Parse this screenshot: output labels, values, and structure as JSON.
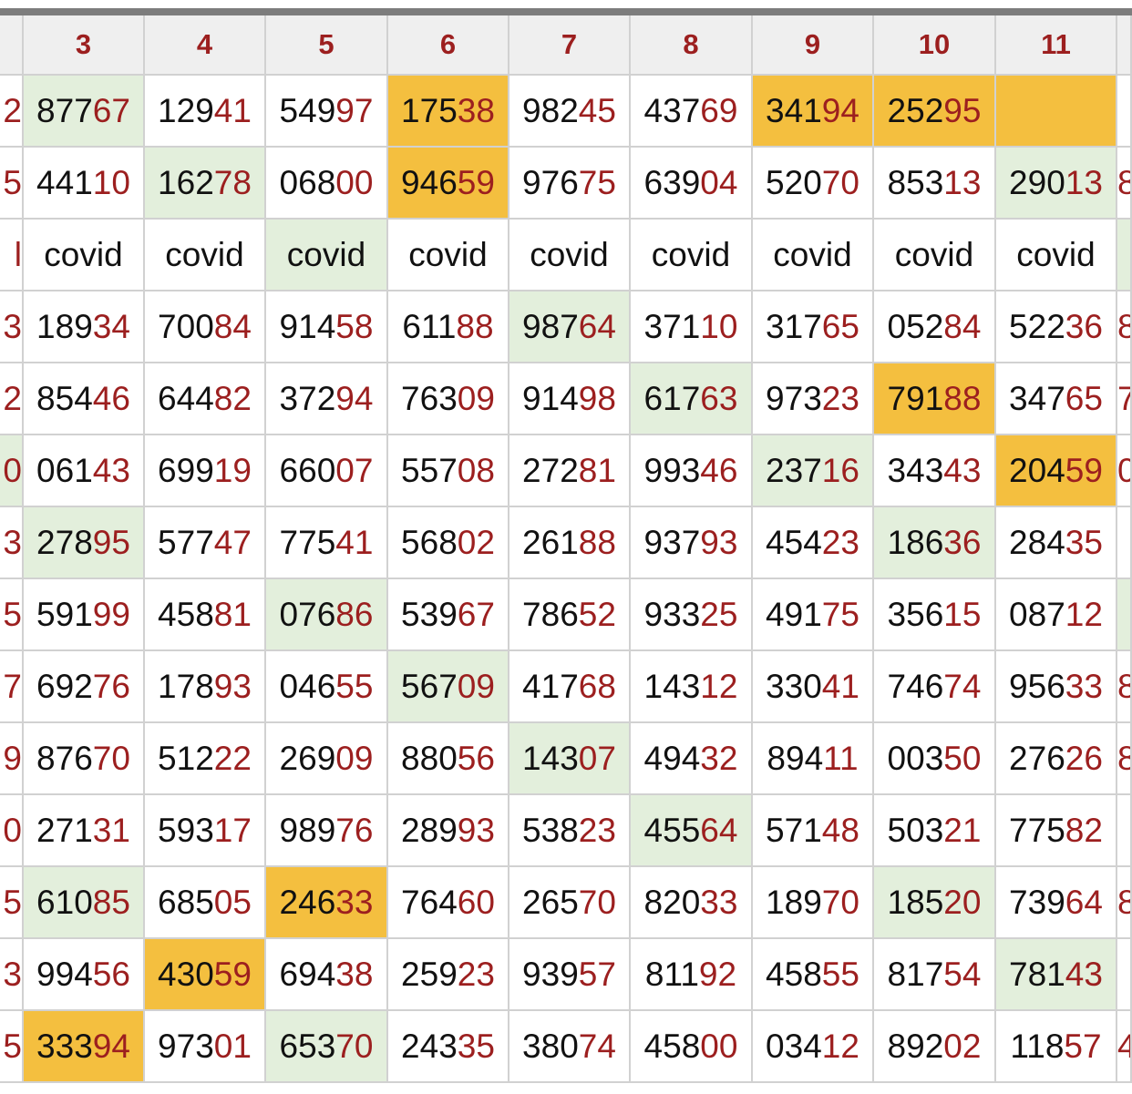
{
  "colors": {
    "green": "#e3efdc",
    "orange": "#f4bf3f",
    "digit_accent": "#9c1f1f",
    "header_bg": "#efefef",
    "grid_line": "#d1d1d1"
  },
  "header": [
    "",
    "3",
    "4",
    "5",
    "6",
    "7",
    "8",
    "9",
    "10",
    "11",
    ""
  ],
  "rows": [
    {
      "cells": [
        {
          "text": "2"
        },
        {
          "text": "87767",
          "hl": "green"
        },
        {
          "text": "12941"
        },
        {
          "text": "54997"
        },
        {
          "text": "17538",
          "hl": "orange"
        },
        {
          "text": "98245"
        },
        {
          "text": "43769"
        },
        {
          "text": "34194",
          "hl": "orange"
        },
        {
          "text": "25295",
          "hl": "orange"
        },
        {
          "text": "",
          "hl": "orange"
        },
        {
          "text": ""
        }
      ]
    },
    {
      "cells": [
        {
          "text": "5"
        },
        {
          "text": "44110"
        },
        {
          "text": "16278",
          "hl": "green"
        },
        {
          "text": "06800"
        },
        {
          "text": "94659",
          "hl": "orange"
        },
        {
          "text": "97675"
        },
        {
          "text": "63904"
        },
        {
          "text": "52070"
        },
        {
          "text": "85313"
        },
        {
          "text": "29013",
          "hl": "green"
        },
        {
          "text": "8"
        }
      ]
    },
    {
      "cells": [
        {
          "text": "l"
        },
        {
          "text": "covid"
        },
        {
          "text": "covid"
        },
        {
          "text": "covid",
          "hl": "green"
        },
        {
          "text": "covid"
        },
        {
          "text": "covid"
        },
        {
          "text": "covid"
        },
        {
          "text": "covid"
        },
        {
          "text": "covid"
        },
        {
          "text": "covid"
        },
        {
          "text": "",
          "hl": "green"
        }
      ]
    },
    {
      "cells": [
        {
          "text": "3"
        },
        {
          "text": "18934"
        },
        {
          "text": "70084"
        },
        {
          "text": "91458"
        },
        {
          "text": "61188"
        },
        {
          "text": "98764",
          "hl": "green"
        },
        {
          "text": "37110"
        },
        {
          "text": "31765"
        },
        {
          "text": "05284"
        },
        {
          "text": "52236"
        },
        {
          "text": "8"
        }
      ]
    },
    {
      "cells": [
        {
          "text": "2"
        },
        {
          "text": "85446"
        },
        {
          "text": "64482"
        },
        {
          "text": "37294"
        },
        {
          "text": "76309"
        },
        {
          "text": "91498"
        },
        {
          "text": "61763",
          "hl": "green"
        },
        {
          "text": "97323"
        },
        {
          "text": "79188",
          "hl": "orange"
        },
        {
          "text": "34765"
        },
        {
          "text": "7"
        }
      ]
    },
    {
      "cells": [
        {
          "text": "0",
          "hl": "green"
        },
        {
          "text": "06143"
        },
        {
          "text": "69919"
        },
        {
          "text": "66007"
        },
        {
          "text": "55708"
        },
        {
          "text": "27281"
        },
        {
          "text": "99346"
        },
        {
          "text": "23716",
          "hl": "green"
        },
        {
          "text": "34343"
        },
        {
          "text": "20459",
          "hl": "orange"
        },
        {
          "text": "0"
        }
      ]
    },
    {
      "cells": [
        {
          "text": "3"
        },
        {
          "text": "27895",
          "hl": "green"
        },
        {
          "text": "57747"
        },
        {
          "text": "77541"
        },
        {
          "text": "56802"
        },
        {
          "text": "26188"
        },
        {
          "text": "93793"
        },
        {
          "text": "45423"
        },
        {
          "text": "18636",
          "hl": "green"
        },
        {
          "text": "28435"
        },
        {
          "text": ""
        }
      ]
    },
    {
      "cells": [
        {
          "text": "5"
        },
        {
          "text": "59199"
        },
        {
          "text": "45881"
        },
        {
          "text": "07686",
          "hl": "green"
        },
        {
          "text": "53967"
        },
        {
          "text": "78652"
        },
        {
          "text": "93325"
        },
        {
          "text": "49175"
        },
        {
          "text": "35615"
        },
        {
          "text": "08712"
        },
        {
          "text": "",
          "hl": "green"
        }
      ]
    },
    {
      "cells": [
        {
          "text": "7"
        },
        {
          "text": "69276"
        },
        {
          "text": "17893"
        },
        {
          "text": "04655"
        },
        {
          "text": "56709",
          "hl": "green"
        },
        {
          "text": "41768"
        },
        {
          "text": "14312"
        },
        {
          "text": "33041"
        },
        {
          "text": "74674"
        },
        {
          "text": "95633"
        },
        {
          "text": "8"
        }
      ]
    },
    {
      "cells": [
        {
          "text": "9"
        },
        {
          "text": "87670"
        },
        {
          "text": "51222"
        },
        {
          "text": "26909"
        },
        {
          "text": "88056"
        },
        {
          "text": "14307",
          "hl": "green"
        },
        {
          "text": "49432"
        },
        {
          "text": "89411"
        },
        {
          "text": "00350"
        },
        {
          "text": "27626"
        },
        {
          "text": "8"
        }
      ]
    },
    {
      "cells": [
        {
          "text": "0"
        },
        {
          "text": "27131"
        },
        {
          "text": "59317"
        },
        {
          "text": "98976"
        },
        {
          "text": "28993"
        },
        {
          "text": "53823"
        },
        {
          "text": "45564",
          "hl": "green"
        },
        {
          "text": "57148"
        },
        {
          "text": "50321"
        },
        {
          "text": "77582"
        },
        {
          "text": ""
        }
      ]
    },
    {
      "cells": [
        {
          "text": "5"
        },
        {
          "text": "61085",
          "hl": "green"
        },
        {
          "text": "68505"
        },
        {
          "text": "24633",
          "hl": "orange"
        },
        {
          "text": "76460"
        },
        {
          "text": "26570"
        },
        {
          "text": "82033"
        },
        {
          "text": "18970"
        },
        {
          "text": "18520",
          "hl": "green"
        },
        {
          "text": "73964"
        },
        {
          "text": "8"
        }
      ]
    },
    {
      "cells": [
        {
          "text": "3"
        },
        {
          "text": "99456"
        },
        {
          "text": "43059",
          "hl": "orange"
        },
        {
          "text": "69438"
        },
        {
          "text": "25923"
        },
        {
          "text": "93957"
        },
        {
          "text": "81192"
        },
        {
          "text": "45855"
        },
        {
          "text": "81754"
        },
        {
          "text": "78143",
          "hl": "green"
        },
        {
          "text": ""
        }
      ]
    },
    {
      "cells": [
        {
          "text": "5"
        },
        {
          "text": "33394",
          "hl": "orange"
        },
        {
          "text": "97301"
        },
        {
          "text": "65370",
          "hl": "green"
        },
        {
          "text": "24335"
        },
        {
          "text": "38074"
        },
        {
          "text": "45800"
        },
        {
          "text": "03412"
        },
        {
          "text": "89202"
        },
        {
          "text": "11857"
        },
        {
          "text": "4"
        }
      ]
    }
  ]
}
